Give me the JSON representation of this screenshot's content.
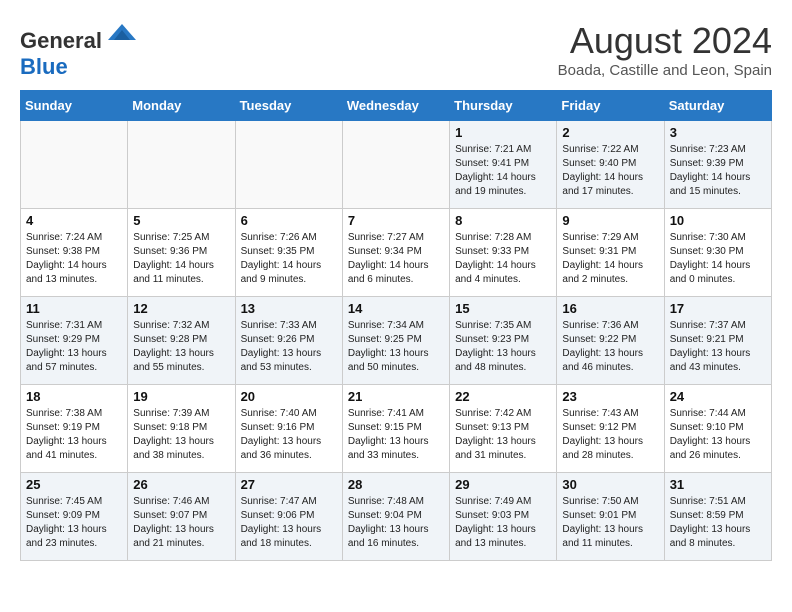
{
  "header": {
    "logo_general": "General",
    "logo_blue": "Blue",
    "month_year": "August 2024",
    "location": "Boada, Castille and Leon, Spain"
  },
  "weekdays": [
    "Sunday",
    "Monday",
    "Tuesday",
    "Wednesday",
    "Thursday",
    "Friday",
    "Saturday"
  ],
  "weeks": [
    [
      {
        "num": "",
        "info": ""
      },
      {
        "num": "",
        "info": ""
      },
      {
        "num": "",
        "info": ""
      },
      {
        "num": "",
        "info": ""
      },
      {
        "num": "1",
        "info": "Sunrise: 7:21 AM\nSunset: 9:41 PM\nDaylight: 14 hours\nand 19 minutes."
      },
      {
        "num": "2",
        "info": "Sunrise: 7:22 AM\nSunset: 9:40 PM\nDaylight: 14 hours\nand 17 minutes."
      },
      {
        "num": "3",
        "info": "Sunrise: 7:23 AM\nSunset: 9:39 PM\nDaylight: 14 hours\nand 15 minutes."
      }
    ],
    [
      {
        "num": "4",
        "info": "Sunrise: 7:24 AM\nSunset: 9:38 PM\nDaylight: 14 hours\nand 13 minutes."
      },
      {
        "num": "5",
        "info": "Sunrise: 7:25 AM\nSunset: 9:36 PM\nDaylight: 14 hours\nand 11 minutes."
      },
      {
        "num": "6",
        "info": "Sunrise: 7:26 AM\nSunset: 9:35 PM\nDaylight: 14 hours\nand 9 minutes."
      },
      {
        "num": "7",
        "info": "Sunrise: 7:27 AM\nSunset: 9:34 PM\nDaylight: 14 hours\nand 6 minutes."
      },
      {
        "num": "8",
        "info": "Sunrise: 7:28 AM\nSunset: 9:33 PM\nDaylight: 14 hours\nand 4 minutes."
      },
      {
        "num": "9",
        "info": "Sunrise: 7:29 AM\nSunset: 9:31 PM\nDaylight: 14 hours\nand 2 minutes."
      },
      {
        "num": "10",
        "info": "Sunrise: 7:30 AM\nSunset: 9:30 PM\nDaylight: 14 hours\nand 0 minutes."
      }
    ],
    [
      {
        "num": "11",
        "info": "Sunrise: 7:31 AM\nSunset: 9:29 PM\nDaylight: 13 hours\nand 57 minutes."
      },
      {
        "num": "12",
        "info": "Sunrise: 7:32 AM\nSunset: 9:28 PM\nDaylight: 13 hours\nand 55 minutes."
      },
      {
        "num": "13",
        "info": "Sunrise: 7:33 AM\nSunset: 9:26 PM\nDaylight: 13 hours\nand 53 minutes."
      },
      {
        "num": "14",
        "info": "Sunrise: 7:34 AM\nSunset: 9:25 PM\nDaylight: 13 hours\nand 50 minutes."
      },
      {
        "num": "15",
        "info": "Sunrise: 7:35 AM\nSunset: 9:23 PM\nDaylight: 13 hours\nand 48 minutes."
      },
      {
        "num": "16",
        "info": "Sunrise: 7:36 AM\nSunset: 9:22 PM\nDaylight: 13 hours\nand 46 minutes."
      },
      {
        "num": "17",
        "info": "Sunrise: 7:37 AM\nSunset: 9:21 PM\nDaylight: 13 hours\nand 43 minutes."
      }
    ],
    [
      {
        "num": "18",
        "info": "Sunrise: 7:38 AM\nSunset: 9:19 PM\nDaylight: 13 hours\nand 41 minutes."
      },
      {
        "num": "19",
        "info": "Sunrise: 7:39 AM\nSunset: 9:18 PM\nDaylight: 13 hours\nand 38 minutes."
      },
      {
        "num": "20",
        "info": "Sunrise: 7:40 AM\nSunset: 9:16 PM\nDaylight: 13 hours\nand 36 minutes."
      },
      {
        "num": "21",
        "info": "Sunrise: 7:41 AM\nSunset: 9:15 PM\nDaylight: 13 hours\nand 33 minutes."
      },
      {
        "num": "22",
        "info": "Sunrise: 7:42 AM\nSunset: 9:13 PM\nDaylight: 13 hours\nand 31 minutes."
      },
      {
        "num": "23",
        "info": "Sunrise: 7:43 AM\nSunset: 9:12 PM\nDaylight: 13 hours\nand 28 minutes."
      },
      {
        "num": "24",
        "info": "Sunrise: 7:44 AM\nSunset: 9:10 PM\nDaylight: 13 hours\nand 26 minutes."
      }
    ],
    [
      {
        "num": "25",
        "info": "Sunrise: 7:45 AM\nSunset: 9:09 PM\nDaylight: 13 hours\nand 23 minutes."
      },
      {
        "num": "26",
        "info": "Sunrise: 7:46 AM\nSunset: 9:07 PM\nDaylight: 13 hours\nand 21 minutes."
      },
      {
        "num": "27",
        "info": "Sunrise: 7:47 AM\nSunset: 9:06 PM\nDaylight: 13 hours\nand 18 minutes."
      },
      {
        "num": "28",
        "info": "Sunrise: 7:48 AM\nSunset: 9:04 PM\nDaylight: 13 hours\nand 16 minutes."
      },
      {
        "num": "29",
        "info": "Sunrise: 7:49 AM\nSunset: 9:03 PM\nDaylight: 13 hours\nand 13 minutes."
      },
      {
        "num": "30",
        "info": "Sunrise: 7:50 AM\nSunset: 9:01 PM\nDaylight: 13 hours\nand 11 minutes."
      },
      {
        "num": "31",
        "info": "Sunrise: 7:51 AM\nSunset: 8:59 PM\nDaylight: 13 hours\nand 8 minutes."
      }
    ]
  ]
}
